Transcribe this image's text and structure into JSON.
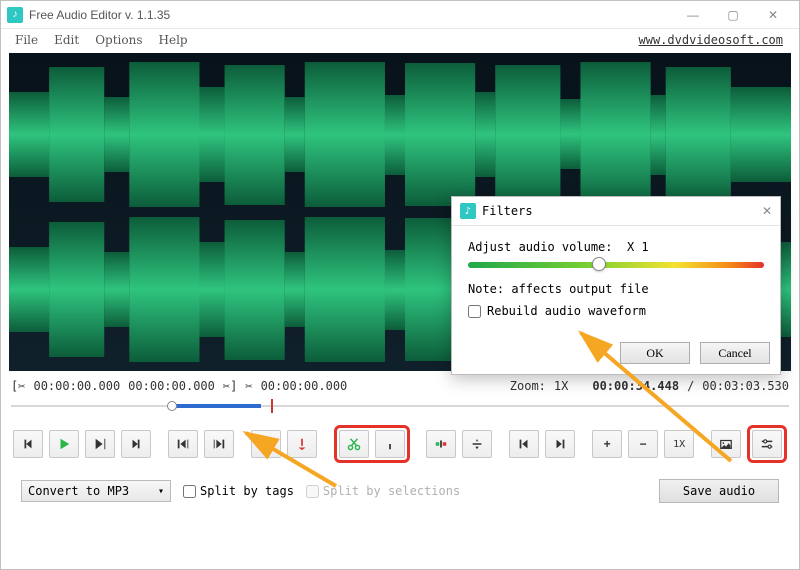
{
  "window": {
    "title": "Free Audio Editor v. 1.1.35",
    "site_link": "www.dvdvideosoft.com"
  },
  "menu": {
    "file": "File",
    "edit": "Edit",
    "options": "Options",
    "help": "Help"
  },
  "time": {
    "sel_start": "00:00:00.000",
    "sel_end": "00:00:00.000",
    "cursor": "00:00:00.000",
    "zoom_label": "Zoom:",
    "zoom_value": "1X",
    "pos": "00:00:34.448",
    "sep": "/",
    "dur": "00:03:03.530"
  },
  "toolbar": {
    "zoom_reset": "1X"
  },
  "bottom": {
    "convert_label": "Convert to MP3",
    "split_tags": "Split by tags",
    "split_sel": "Split by selections",
    "save": "Save audio"
  },
  "filters": {
    "title": "Filters",
    "adjust_label": "Adjust audio volume:",
    "adjust_value": "X 1",
    "note": "Note: affects output file",
    "rebuild": "Rebuild audio waveform",
    "ok": "OK",
    "cancel": "Cancel"
  }
}
